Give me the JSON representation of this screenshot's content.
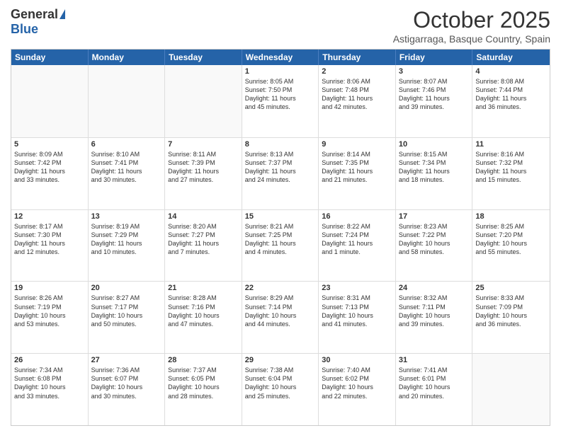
{
  "logo": {
    "general": "General",
    "blue": "Blue"
  },
  "title": "October 2025",
  "location": "Astigarraga, Basque Country, Spain",
  "header_days": [
    "Sunday",
    "Monday",
    "Tuesday",
    "Wednesday",
    "Thursday",
    "Friday",
    "Saturday"
  ],
  "weeks": [
    [
      {
        "day": "",
        "text": ""
      },
      {
        "day": "",
        "text": ""
      },
      {
        "day": "",
        "text": ""
      },
      {
        "day": "1",
        "text": "Sunrise: 8:05 AM\nSunset: 7:50 PM\nDaylight: 11 hours\nand 45 minutes."
      },
      {
        "day": "2",
        "text": "Sunrise: 8:06 AM\nSunset: 7:48 PM\nDaylight: 11 hours\nand 42 minutes."
      },
      {
        "day": "3",
        "text": "Sunrise: 8:07 AM\nSunset: 7:46 PM\nDaylight: 11 hours\nand 39 minutes."
      },
      {
        "day": "4",
        "text": "Sunrise: 8:08 AM\nSunset: 7:44 PM\nDaylight: 11 hours\nand 36 minutes."
      }
    ],
    [
      {
        "day": "5",
        "text": "Sunrise: 8:09 AM\nSunset: 7:42 PM\nDaylight: 11 hours\nand 33 minutes."
      },
      {
        "day": "6",
        "text": "Sunrise: 8:10 AM\nSunset: 7:41 PM\nDaylight: 11 hours\nand 30 minutes."
      },
      {
        "day": "7",
        "text": "Sunrise: 8:11 AM\nSunset: 7:39 PM\nDaylight: 11 hours\nand 27 minutes."
      },
      {
        "day": "8",
        "text": "Sunrise: 8:13 AM\nSunset: 7:37 PM\nDaylight: 11 hours\nand 24 minutes."
      },
      {
        "day": "9",
        "text": "Sunrise: 8:14 AM\nSunset: 7:35 PM\nDaylight: 11 hours\nand 21 minutes."
      },
      {
        "day": "10",
        "text": "Sunrise: 8:15 AM\nSunset: 7:34 PM\nDaylight: 11 hours\nand 18 minutes."
      },
      {
        "day": "11",
        "text": "Sunrise: 8:16 AM\nSunset: 7:32 PM\nDaylight: 11 hours\nand 15 minutes."
      }
    ],
    [
      {
        "day": "12",
        "text": "Sunrise: 8:17 AM\nSunset: 7:30 PM\nDaylight: 11 hours\nand 12 minutes."
      },
      {
        "day": "13",
        "text": "Sunrise: 8:19 AM\nSunset: 7:29 PM\nDaylight: 11 hours\nand 10 minutes."
      },
      {
        "day": "14",
        "text": "Sunrise: 8:20 AM\nSunset: 7:27 PM\nDaylight: 11 hours\nand 7 minutes."
      },
      {
        "day": "15",
        "text": "Sunrise: 8:21 AM\nSunset: 7:25 PM\nDaylight: 11 hours\nand 4 minutes."
      },
      {
        "day": "16",
        "text": "Sunrise: 8:22 AM\nSunset: 7:24 PM\nDaylight: 11 hours\nand 1 minute."
      },
      {
        "day": "17",
        "text": "Sunrise: 8:23 AM\nSunset: 7:22 PM\nDaylight: 10 hours\nand 58 minutes."
      },
      {
        "day": "18",
        "text": "Sunrise: 8:25 AM\nSunset: 7:20 PM\nDaylight: 10 hours\nand 55 minutes."
      }
    ],
    [
      {
        "day": "19",
        "text": "Sunrise: 8:26 AM\nSunset: 7:19 PM\nDaylight: 10 hours\nand 53 minutes."
      },
      {
        "day": "20",
        "text": "Sunrise: 8:27 AM\nSunset: 7:17 PM\nDaylight: 10 hours\nand 50 minutes."
      },
      {
        "day": "21",
        "text": "Sunrise: 8:28 AM\nSunset: 7:16 PM\nDaylight: 10 hours\nand 47 minutes."
      },
      {
        "day": "22",
        "text": "Sunrise: 8:29 AM\nSunset: 7:14 PM\nDaylight: 10 hours\nand 44 minutes."
      },
      {
        "day": "23",
        "text": "Sunrise: 8:31 AM\nSunset: 7:13 PM\nDaylight: 10 hours\nand 41 minutes."
      },
      {
        "day": "24",
        "text": "Sunrise: 8:32 AM\nSunset: 7:11 PM\nDaylight: 10 hours\nand 39 minutes."
      },
      {
        "day": "25",
        "text": "Sunrise: 8:33 AM\nSunset: 7:09 PM\nDaylight: 10 hours\nand 36 minutes."
      }
    ],
    [
      {
        "day": "26",
        "text": "Sunrise: 7:34 AM\nSunset: 6:08 PM\nDaylight: 10 hours\nand 33 minutes."
      },
      {
        "day": "27",
        "text": "Sunrise: 7:36 AM\nSunset: 6:07 PM\nDaylight: 10 hours\nand 30 minutes."
      },
      {
        "day": "28",
        "text": "Sunrise: 7:37 AM\nSunset: 6:05 PM\nDaylight: 10 hours\nand 28 minutes."
      },
      {
        "day": "29",
        "text": "Sunrise: 7:38 AM\nSunset: 6:04 PM\nDaylight: 10 hours\nand 25 minutes."
      },
      {
        "day": "30",
        "text": "Sunrise: 7:40 AM\nSunset: 6:02 PM\nDaylight: 10 hours\nand 22 minutes."
      },
      {
        "day": "31",
        "text": "Sunrise: 7:41 AM\nSunset: 6:01 PM\nDaylight: 10 hours\nand 20 minutes."
      },
      {
        "day": "",
        "text": ""
      }
    ]
  ]
}
